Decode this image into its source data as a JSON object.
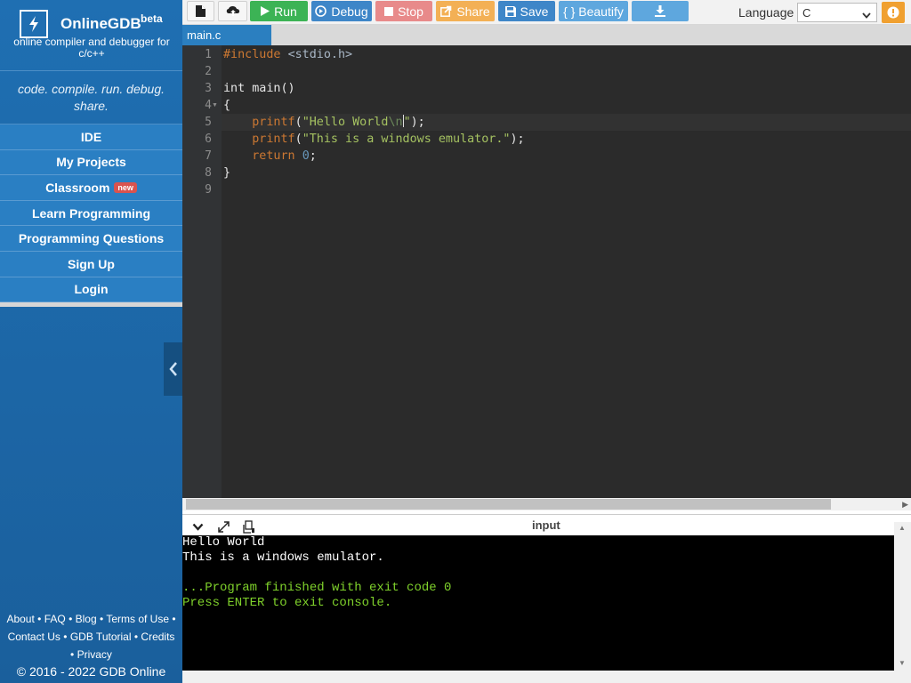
{
  "sidebar": {
    "brand_name": "OnlineGDB",
    "brand_beta": "beta",
    "brand_subtitle": "online compiler and debugger for c/c++",
    "tagline": "code. compile. run. debug. share.",
    "nav": [
      {
        "label": "IDE"
      },
      {
        "label": "My Projects"
      },
      {
        "label": "Classroom",
        "badge": "new"
      },
      {
        "label": "Learn Programming"
      },
      {
        "label": "Programming Questions"
      },
      {
        "label": "Sign Up"
      },
      {
        "label": "Login"
      }
    ],
    "footer": {
      "links": [
        "About",
        "FAQ",
        "Blog",
        "Terms of Use",
        "Contact Us",
        "GDB Tutorial",
        "Credits",
        "Privacy"
      ],
      "separator": "•",
      "copyright": "© 2016 - 2022 GDB Online"
    }
  },
  "toolbar": {
    "run_label": "Run",
    "debug_label": "Debug",
    "stop_label": "Stop",
    "share_label": "Share",
    "save_label": "Save",
    "beautify_label": "{ } Beautify",
    "language_label": "Language",
    "language_value": "C"
  },
  "tabs": [
    {
      "label": "main.c"
    }
  ],
  "editor": {
    "line_numbers": [
      "1",
      "2",
      "3",
      "4",
      "5",
      "6",
      "7",
      "8",
      "9"
    ],
    "lines": [
      [
        {
          "t": "#include ",
          "c": "k-pre"
        },
        {
          "t": "<stdio.h>",
          "c": "k-inc"
        }
      ],
      [],
      [
        {
          "t": "int main()",
          "c": "k-plain"
        }
      ],
      [
        {
          "t": "{",
          "c": "k-plain"
        }
      ],
      [
        {
          "t": "    ",
          "c": "k-plain"
        },
        {
          "t": "printf",
          "c": "k-fn"
        },
        {
          "t": "(",
          "c": "k-plain"
        },
        {
          "t": "\"Hello World",
          "c": "k-str"
        },
        {
          "t": "\\n",
          "c": "k-esc"
        },
        {
          "t": "\"",
          "c": "k-str"
        },
        {
          "t": ");",
          "c": "k-plain"
        }
      ],
      [
        {
          "t": "    ",
          "c": "k-plain"
        },
        {
          "t": "printf",
          "c": "k-fn"
        },
        {
          "t": "(",
          "c": "k-plain"
        },
        {
          "t": "\"This is a windows emulator.\"",
          "c": "k-str"
        },
        {
          "t": ");",
          "c": "k-plain"
        }
      ],
      [
        {
          "t": "    ",
          "c": "k-plain"
        },
        {
          "t": "return",
          "c": "k-fn"
        },
        {
          "t": " ",
          "c": "k-plain"
        },
        {
          "t": "0",
          "c": "k-num"
        },
        {
          "t": ";",
          "c": "k-plain"
        }
      ],
      [
        {
          "t": "}",
          "c": "k-plain"
        }
      ],
      []
    ]
  },
  "console": {
    "header_label": "input",
    "output_lines": [
      {
        "text": "Hello World",
        "color": "white"
      },
      {
        "text": "This is a windows emulator.",
        "color": "white"
      },
      {
        "text": "",
        "color": "white"
      },
      {
        "text": "...Program finished with exit code 0",
        "color": "green"
      },
      {
        "text": "Press ENTER to exit console.",
        "color": "green"
      }
    ]
  },
  "colors": {
    "sidebar_blue": "#1f6fb2",
    "run_green": "#3cb355",
    "debug_blue": "#3e86c8",
    "stop_red": "#e88a8a",
    "share_orange": "#f3b055",
    "editor_bg": "#2b2b2b",
    "console_bg": "#000000",
    "console_green": "#7fd12b"
  }
}
